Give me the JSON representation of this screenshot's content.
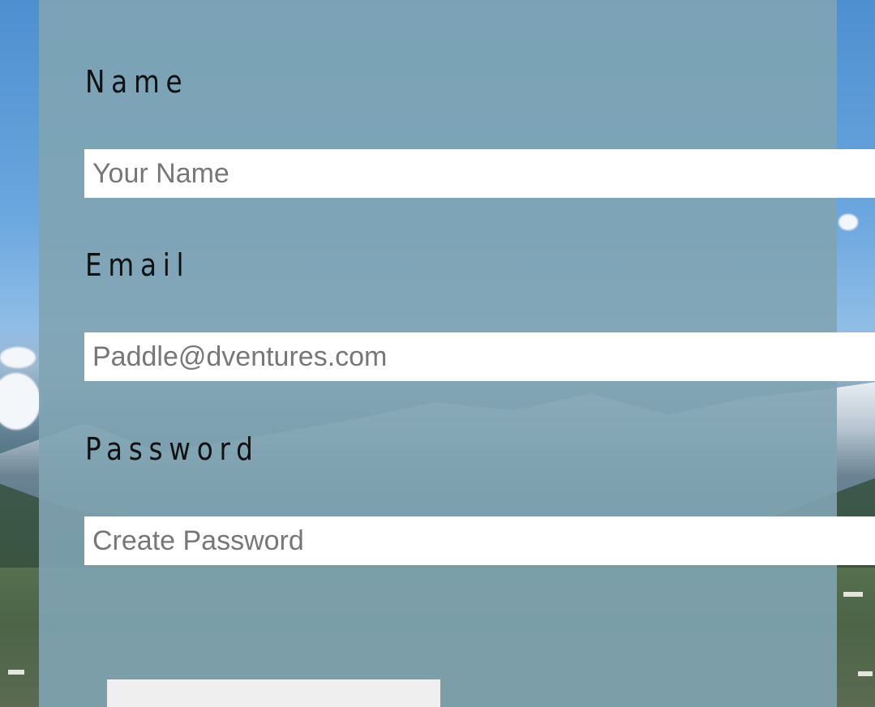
{
  "form": {
    "name_label": "Name",
    "name_placeholder": "Your Name",
    "email_label": "Email",
    "email_placeholder": "Paddle@dventures.com",
    "password_label": "Password",
    "password_placeholder": "Create Password"
  }
}
